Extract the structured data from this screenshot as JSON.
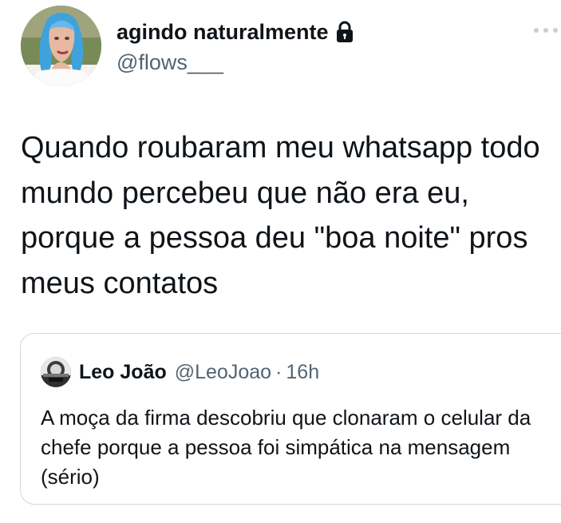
{
  "tweet": {
    "author": {
      "display_name": "agindo naturalmente",
      "handle": "@flows___",
      "locked_icon": "lock-icon",
      "avatar_icon": "avatar"
    },
    "more_icon": "more-horizontal-icon",
    "text": "Quando roubaram meu whatsapp todo mundo percebeu que não era eu, porque a pessoa deu \"boa noite\" pros meus contatos"
  },
  "quoted_tweet": {
    "author": {
      "display_name": "Leo João",
      "handle": "@LeoJoao",
      "separator": "·",
      "time": "16h",
      "avatar_icon": "avatar"
    },
    "text": "A moça da firma descobriu que clonaram o celular da chefe porque a pessoa foi simpática na mensagem (sério)"
  },
  "colors": {
    "primary_text": "#0f1419",
    "secondary_text": "#536471",
    "border": "#cfd9de",
    "background": "#ffffff",
    "avatar_hair": "#4aa6df",
    "avatar_background": "#7b8a5d"
  }
}
